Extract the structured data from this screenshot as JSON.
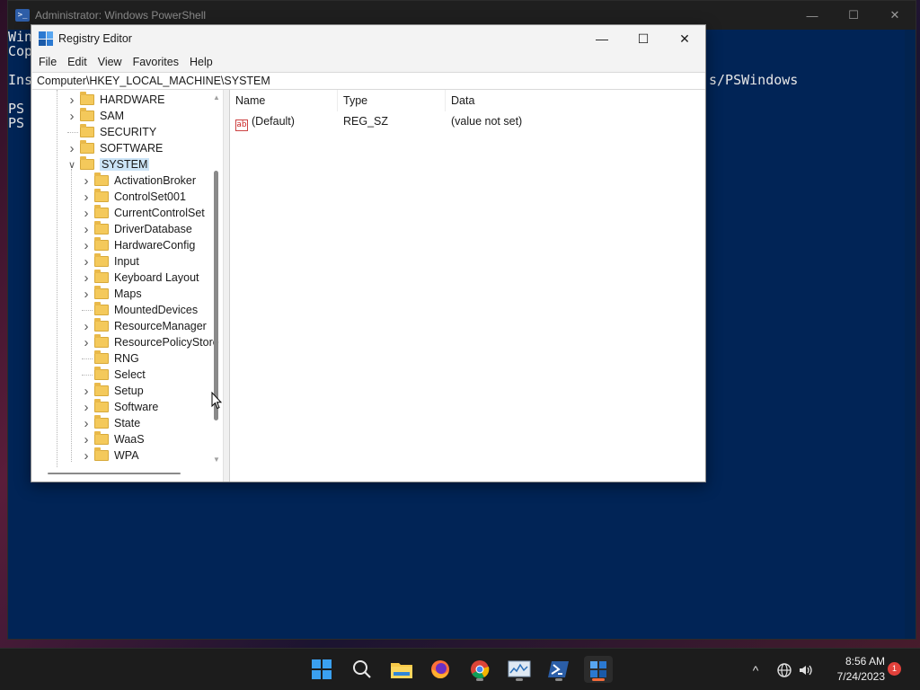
{
  "powershell": {
    "title": "Administrator: Windows PowerShell",
    "lines": [
      "Win",
      "Cop",
      "",
      "Ins",
      "",
      "PS",
      "PS"
    ],
    "line_right": "s/PSWindows",
    "btn_minimize": "—",
    "btn_maximize": "☐",
    "btn_close": "✕"
  },
  "regedit": {
    "title": "Registry Editor",
    "btn_minimize": "—",
    "btn_maximize": "☐",
    "btn_close": "✕",
    "menu": [
      "File",
      "Edit",
      "View",
      "Favorites",
      "Help"
    ],
    "address": "Computer\\HKEY_LOCAL_MACHINE\\SYSTEM",
    "tree_top": [
      {
        "label": "HARDWARE",
        "expandable": true
      },
      {
        "label": "SAM",
        "expandable": true
      },
      {
        "label": "SECURITY",
        "expandable": false
      },
      {
        "label": "SOFTWARE",
        "expandable": true
      },
      {
        "label": "SYSTEM",
        "expandable": true,
        "expanded": true,
        "selected": true
      }
    ],
    "tree_children": [
      {
        "label": "ActivationBroker",
        "expandable": true
      },
      {
        "label": "ControlSet001",
        "expandable": true
      },
      {
        "label": "CurrentControlSet",
        "expandable": true
      },
      {
        "label": "DriverDatabase",
        "expandable": true
      },
      {
        "label": "HardwareConfig",
        "expandable": true
      },
      {
        "label": "Input",
        "expandable": true
      },
      {
        "label": "Keyboard Layout",
        "expandable": true
      },
      {
        "label": "Maps",
        "expandable": true
      },
      {
        "label": "MountedDevices",
        "expandable": false
      },
      {
        "label": "ResourceManager",
        "expandable": true
      },
      {
        "label": "ResourcePolicyStore",
        "expandable": true
      },
      {
        "label": "RNG",
        "expandable": false
      },
      {
        "label": "Select",
        "expandable": false
      },
      {
        "label": "Setup",
        "expandable": true
      },
      {
        "label": "Software",
        "expandable": true
      },
      {
        "label": "State",
        "expandable": true
      },
      {
        "label": "WaaS",
        "expandable": true
      },
      {
        "label": "WPA",
        "expandable": true
      }
    ],
    "columns": {
      "name": "Name",
      "type": "Type",
      "data": "Data"
    },
    "values": [
      {
        "name": "(Default)",
        "type": "REG_SZ",
        "data": "(value not set)",
        "icon": "ab"
      }
    ]
  },
  "taskbar": {
    "apps": [
      "start-icon",
      "search-icon",
      "file-explorer-icon",
      "firefox-icon",
      "chrome-icon",
      "resource-monitor-icon",
      "powershell-icon",
      "registry-editor-icon"
    ],
    "time": "8:56 AM",
    "date": "7/24/2023",
    "notification_count": "1",
    "tray_chevron": "^"
  }
}
